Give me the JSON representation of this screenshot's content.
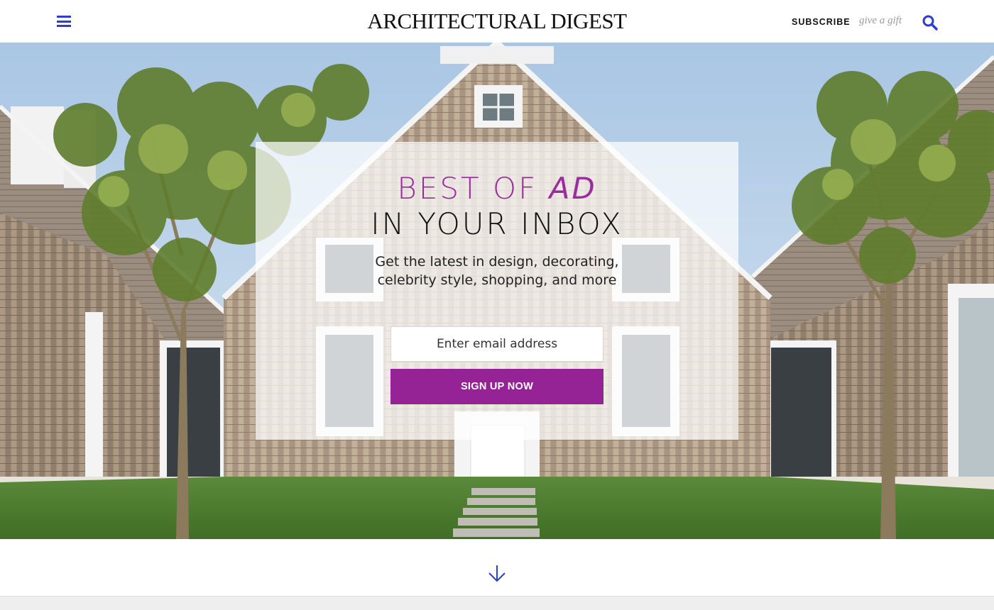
{
  "header": {
    "menu_icon": "hamburger-menu-icon",
    "logo": "ARCHITECTURAL DIGEST",
    "subscribe_label": "SUBSCRIBE",
    "gift_label": "give a gift",
    "search_icon": "search-icon",
    "accent_color": "#2d3ec7"
  },
  "hero": {
    "headline_prefix": "BEST OF ",
    "headline_italic": "AD",
    "headline_line2": "IN YOUR INBOX",
    "description": "Get the latest in design, decorating, celebrity style, shopping, and more",
    "email_placeholder": "Enter email address",
    "signup_label": "SIGN UP NOW",
    "headline_color": "#9b2c9e",
    "button_color": "#952395"
  },
  "footer": {
    "scroll_icon": "arrow-down-icon"
  }
}
